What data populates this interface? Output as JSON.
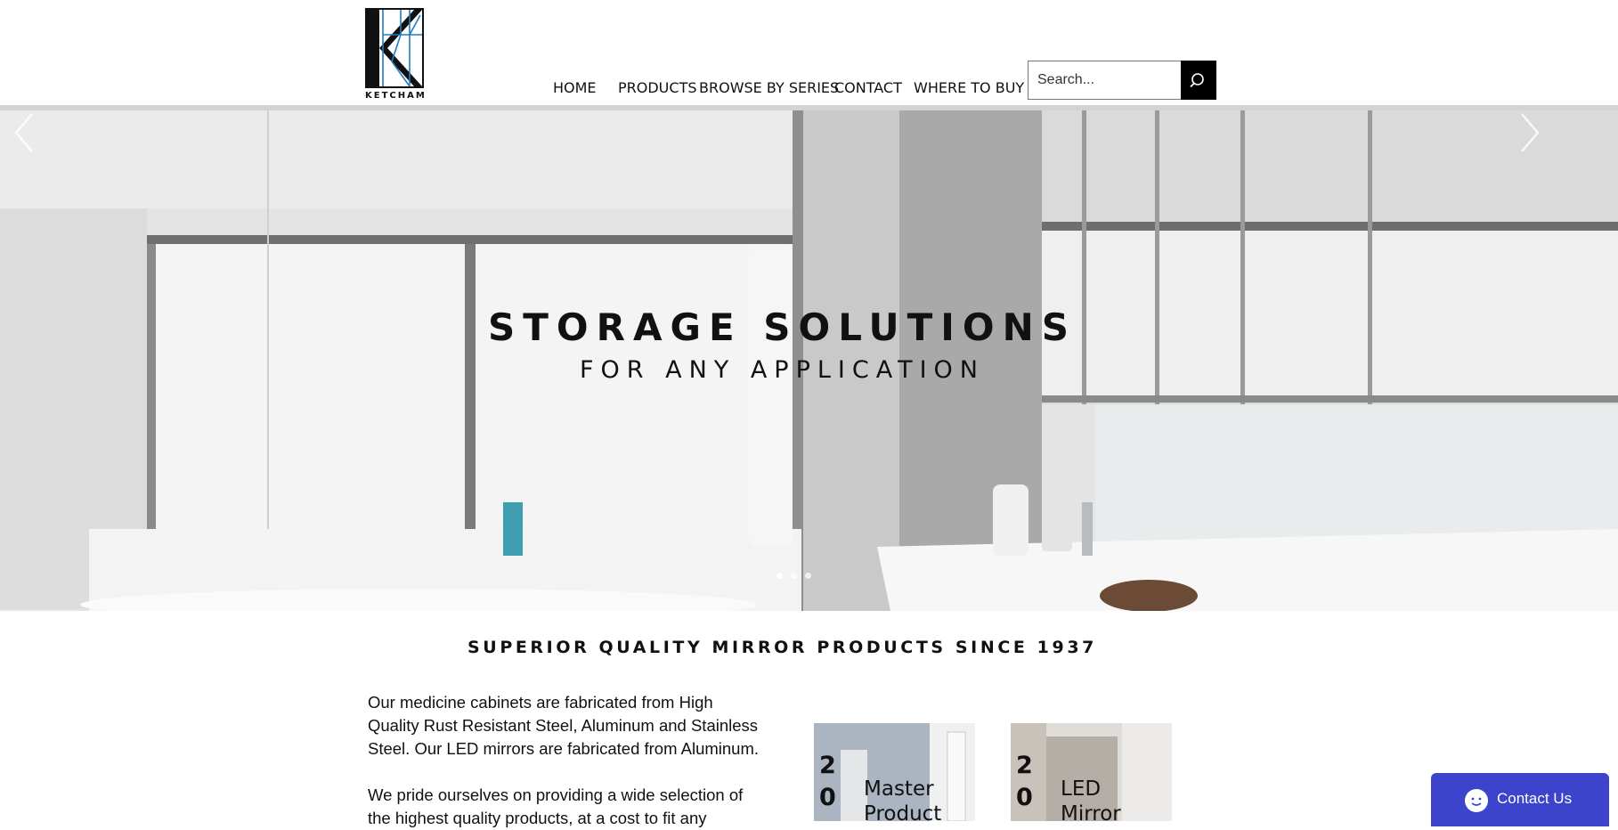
{
  "brand": {
    "logo_text": "KETCHAM"
  },
  "nav": {
    "items": [
      "HOME",
      "PRODUCTS",
      "BROWSE BY SERIES",
      "CONTACT",
      "WHERE TO BUY"
    ]
  },
  "search": {
    "placeholder": "Search..."
  },
  "hero": {
    "title": "STORAGE SOLUTIONS",
    "subtitle": "FOR ANY APPLICATION",
    "slide_count": 3,
    "active_slide": 0
  },
  "tagline": "SUPERIOR QUALITY MIRROR PRODUCTS SINCE 1937",
  "intro": {
    "p1": "Our medicine cabinets are fabricated from High Quality Rust Resistant Steel, Aluminum and Stainless Steel. Our LED mirrors are fabricated from Aluminum.",
    "p2": "We pride ourselves on providing a wide selection of the highest quality products, at a cost to fit any"
  },
  "cards": [
    {
      "year": "20",
      "title_line1": "Master",
      "title_line2": "Product"
    },
    {
      "year": "20",
      "title_line1": "LED",
      "title_line2": "Mirror"
    }
  ],
  "chat": {
    "label": "Contact Us"
  },
  "colors": {
    "accent": "#3c44cc",
    "logo_blue": "#1f7fbf"
  }
}
